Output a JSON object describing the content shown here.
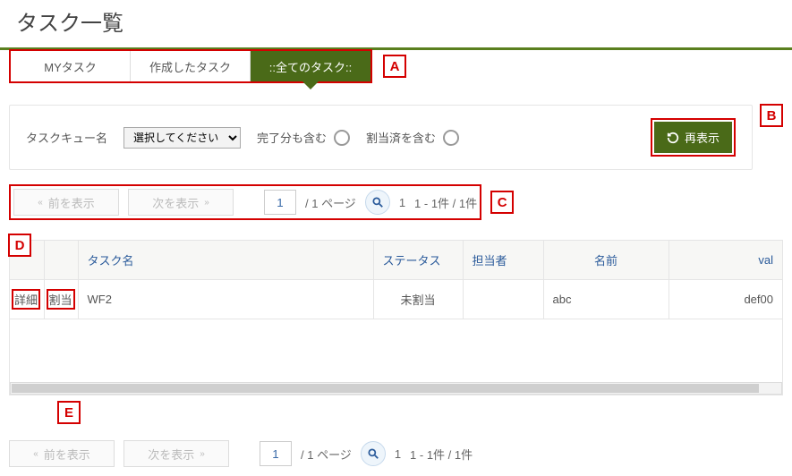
{
  "page_title": "タスク一覧",
  "tabs": {
    "my": "MYタスク",
    "created": "作成したタスク",
    "all": "::全てのタスク::"
  },
  "markers": {
    "a": "A",
    "b": "B",
    "c": "C",
    "d": "D",
    "e": "E"
  },
  "filter": {
    "queue_label": "タスクキュー名",
    "select_placeholder": "選択してください",
    "include_completed": "完了分も含む",
    "include_assigned": "割当済を含む",
    "refresh": "再表示"
  },
  "pager": {
    "prev": "前を表示",
    "next": "次を表示",
    "page_value": "1",
    "page_total": "/  1 ページ",
    "range": "1",
    "range_text": "1 - 1件 / 1件"
  },
  "table": {
    "headers": {
      "task_name": "タスク名",
      "status": "ステータス",
      "assignee": "担当者",
      "name": "名前",
      "val": "val"
    },
    "row": {
      "detail": "詳細",
      "assign": "割当",
      "task_name": "WF2",
      "status": "未割当",
      "assignee": "",
      "name": "abc",
      "val": "def00"
    }
  }
}
